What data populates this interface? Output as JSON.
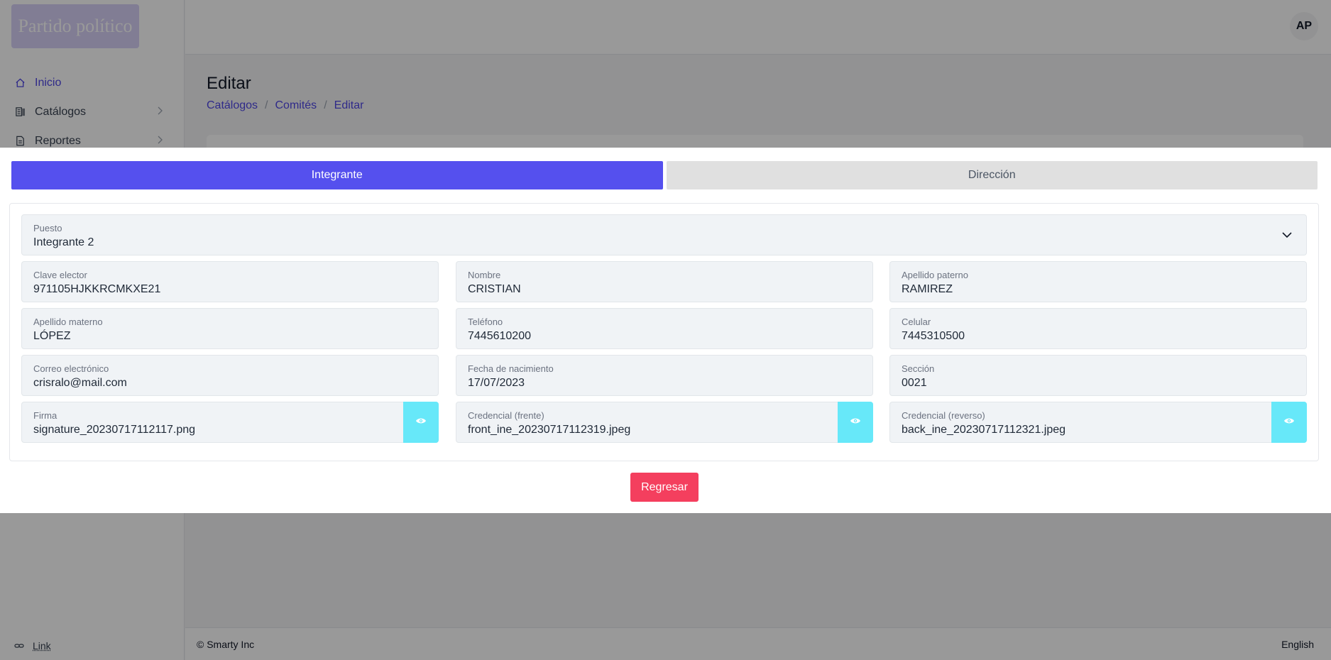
{
  "brand": {
    "logo_text": "Partido político"
  },
  "sidebar": {
    "items": [
      {
        "label": "Inicio",
        "icon": "home-icon"
      },
      {
        "label": "Catálogos",
        "icon": "catalog-icon"
      },
      {
        "label": "Reportes",
        "icon": "report-icon"
      }
    ],
    "link_label": "Link"
  },
  "header": {
    "avatar_initials": "AP"
  },
  "page": {
    "title": "Editar",
    "breadcrumb": [
      "Catálogos",
      "Comités",
      "Editar"
    ],
    "breadcrumb_separator": "/"
  },
  "footer": {
    "copyright": "© Smarty Inc",
    "language": "English"
  },
  "modal": {
    "tabs": [
      {
        "label": "Integrante",
        "active": true
      },
      {
        "label": "Dirección",
        "active": false
      }
    ],
    "puesto": {
      "label": "Puesto",
      "value": "Integrante 2"
    },
    "fields": [
      {
        "label": "Clave elector",
        "value": "971105HJKKRCMKXE21"
      },
      {
        "label": "Nombre",
        "value": "CRISTIAN"
      },
      {
        "label": "Apellido paterno",
        "value": "RAMIREZ"
      },
      {
        "label": "Apellido materno",
        "value": "LÓPEZ"
      },
      {
        "label": "Teléfono",
        "value": "7445610200"
      },
      {
        "label": "Celular",
        "value": "7445310500"
      },
      {
        "label": "Correo electrónico",
        "value": "crisralo@mail.com"
      },
      {
        "label": "Fecha de nacimiento",
        "value": "17/07/2023"
      },
      {
        "label": "Sección",
        "value": "0021"
      }
    ],
    "files": [
      {
        "label": "Firma",
        "value": "signature_20230717112117.png"
      },
      {
        "label": "Credencial (frente)",
        "value": "front_ine_20230717112319.jpeg"
      },
      {
        "label": "Credencial (reverso)",
        "value": "back_ine_20230717112321.jpeg"
      }
    ],
    "back_button": "Regresar"
  },
  "colors": {
    "primary": "#5550ee",
    "info": "#67e8f9",
    "danger": "#f43f5e"
  }
}
